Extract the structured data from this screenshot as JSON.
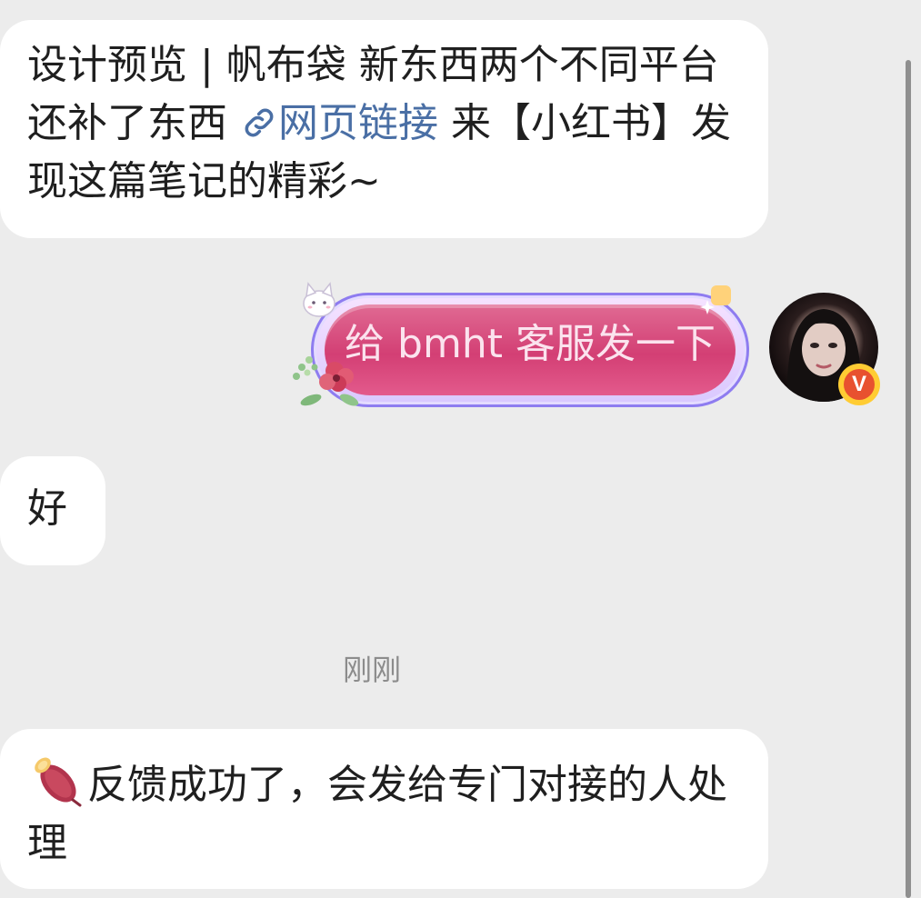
{
  "messages": [
    {
      "id": "shared-link",
      "direction": "incoming",
      "text_before_link": "设计预览 | 帆布袋 新东西两个不同平台 还补了东西 ",
      "link_label": "网页链接",
      "text_after_link": " 来【小红书】发现这篇笔记的精彩~",
      "link_icon": "link-icon"
    },
    {
      "id": "request",
      "direction": "outgoing",
      "text": "给 bmht 客服发一下",
      "decorations": [
        "cat-icon",
        "flowers-icon",
        "sparkle-icon"
      ]
    },
    {
      "id": "reply-ok",
      "direction": "incoming",
      "text": "好"
    },
    {
      "id": "feedback",
      "direction": "incoming",
      "icon": "sweet-potato-icon",
      "text": "反馈成功了，会发给专门对接的人处理"
    }
  ],
  "timestamp": "刚刚",
  "avatar": {
    "badge_letter": "V",
    "badge_color": "#e8512f",
    "badge_ring_color": "#ffcc33"
  },
  "colors": {
    "background": "#ececec",
    "incoming_bubble": "#ffffff",
    "outgoing_bubble": "#d33f74",
    "link": "#4a6fa5",
    "timestamp": "#8c8c8c"
  }
}
